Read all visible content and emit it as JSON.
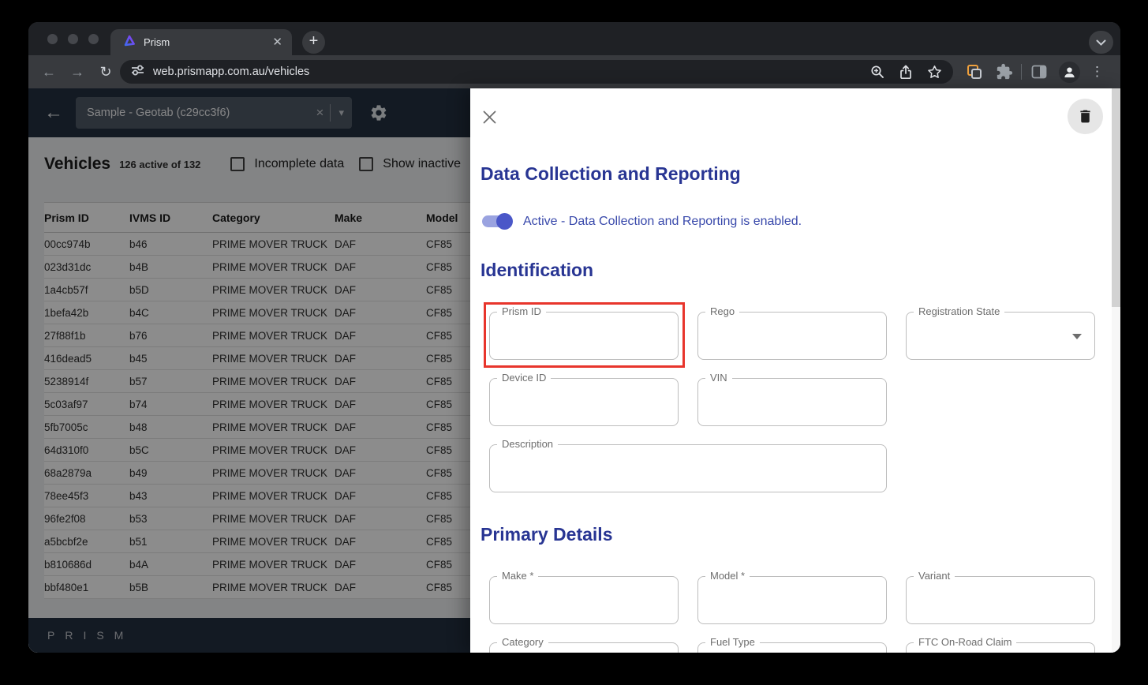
{
  "browser": {
    "tab_title": "Prism",
    "url": "web.prismapp.com.au/vehicles"
  },
  "app_bar": {
    "dataset_value": "Sample - Geotab (c29cc3f6)"
  },
  "page": {
    "title": "Vehicles",
    "count_label": "126 active of 132",
    "filters": [
      {
        "label": "Incomplete data",
        "checked": false
      },
      {
        "label": "Show inactive",
        "checked": false
      }
    ],
    "table": {
      "columns": [
        "Prism ID",
        "IVMS ID",
        "Category",
        "Make",
        "Model"
      ],
      "rows": [
        [
          "00cc974b",
          "b46",
          "PRIME MOVER TRUCK",
          "DAF",
          "CF85"
        ],
        [
          "023d31dc",
          "b4B",
          "PRIME MOVER TRUCK",
          "DAF",
          "CF85"
        ],
        [
          "1a4cb57f",
          "b5D",
          "PRIME MOVER TRUCK",
          "DAF",
          "CF85"
        ],
        [
          "1befa42b",
          "b4C",
          "PRIME MOVER TRUCK",
          "DAF",
          "CF85"
        ],
        [
          "27f88f1b",
          "b76",
          "PRIME MOVER TRUCK",
          "DAF",
          "CF85"
        ],
        [
          "416dead5",
          "b45",
          "PRIME MOVER TRUCK",
          "DAF",
          "CF85"
        ],
        [
          "5238914f",
          "b57",
          "PRIME MOVER TRUCK",
          "DAF",
          "CF85"
        ],
        [
          "5c03af97",
          "b74",
          "PRIME MOVER TRUCK",
          "DAF",
          "CF85"
        ],
        [
          "5fb7005c",
          "b48",
          "PRIME MOVER TRUCK",
          "DAF",
          "CF85"
        ],
        [
          "64d310f0",
          "b5C",
          "PRIME MOVER TRUCK",
          "DAF",
          "CF85"
        ],
        [
          "68a2879a",
          "b49",
          "PRIME MOVER TRUCK",
          "DAF",
          "CF85"
        ],
        [
          "78ee45f3",
          "b43",
          "PRIME MOVER TRUCK",
          "DAF",
          "CF85"
        ],
        [
          "96fe2f08",
          "b53",
          "PRIME MOVER TRUCK",
          "DAF",
          "CF85"
        ],
        [
          "a5bcbf2e",
          "b51",
          "PRIME MOVER TRUCK",
          "DAF",
          "CF85"
        ],
        [
          "b810686d",
          "b4A",
          "PRIME MOVER TRUCK",
          "DAF",
          "CF85"
        ],
        [
          "bbf480e1",
          "b5B",
          "PRIME MOVER TRUCK",
          "DAF",
          "CF85"
        ]
      ]
    },
    "footer_logo": "PRISM"
  },
  "drawer": {
    "reporting": {
      "title": "Data Collection and Reporting",
      "toggle_on": true,
      "toggle_label": "Active - Data Collection and Reporting is enabled."
    },
    "identification": {
      "title": "Identification",
      "fields": {
        "prism_id": "Prism ID",
        "rego": "Rego",
        "registration_state": "Registration State",
        "device_id": "Device ID",
        "vin": "VIN",
        "description": "Description"
      }
    },
    "primary_details": {
      "title": "Primary Details",
      "fields": {
        "make": "Make *",
        "model": "Model *",
        "variant": "Variant",
        "category": "Category",
        "fuel_type": "Fuel Type",
        "ftc_on_road_claim": "FTC On-Road Claim"
      }
    }
  },
  "colors": {
    "heading_indigo": "#283593",
    "toggle_indigo": "#4a57c8",
    "toggle_label_indigo": "#3949ab",
    "highlight_red": "#e8352c",
    "app_bar_navy": "#243040"
  }
}
